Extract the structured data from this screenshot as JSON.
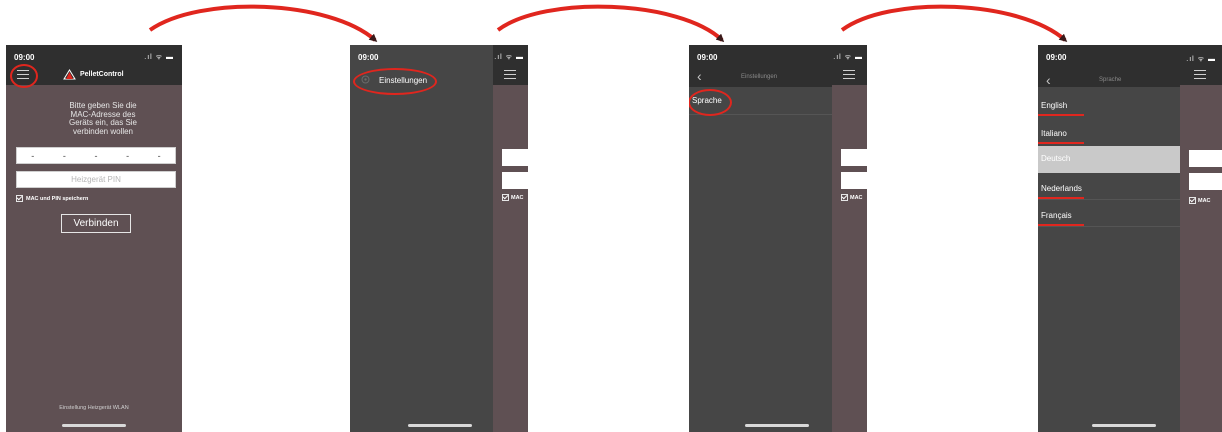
{
  "status": {
    "time": "09:00",
    "icons": ".ıl ᯤ ▬"
  },
  "screen1": {
    "brand": "PelletControl",
    "instructions": "Bitte geben Sie die\nMAC-Adresse des\nGeräts ein, das Sie\nverbinden wollen",
    "mac_placeholder": [
      "-",
      "-",
      "-",
      "-",
      "-"
    ],
    "pin_placeholder": "Heizgerät PIN",
    "save_label": "MAC und PIN speichern",
    "connect_label": "Verbinden",
    "footer_link": "Einstellung Heizgerät WLAN"
  },
  "screen2": {
    "menu_item": "Einstellungen",
    "ghost_check_label": "MAC"
  },
  "screen3": {
    "title": "Einstellungen",
    "item": "Sprache",
    "ghost_check_label": "MAC"
  },
  "screen4": {
    "title": "Sprache",
    "languages": [
      "English",
      "Italiano",
      "Deutsch",
      "Nederlands",
      "Français"
    ],
    "selected": "Deutsch",
    "ghost_check_label": "MAC"
  },
  "colors": {
    "accent": "#e0261e",
    "app_bg": "#5f5053",
    "menu_bg": "#464646",
    "bar_bg": "#2f2f2f",
    "selected": "#c9c9c9"
  }
}
